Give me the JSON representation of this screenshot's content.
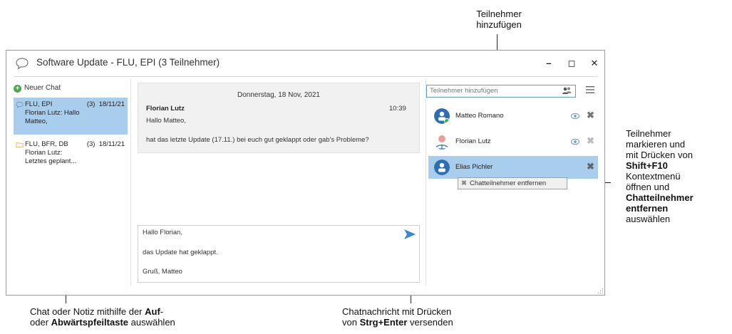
{
  "window": {
    "title": "Software Update - FLU, EPI (3 Teilnehmer)",
    "minimize": "–",
    "maximize": "◻",
    "close": "✕"
  },
  "left_pane": {
    "new_chat": "Neuer Chat",
    "chats": [
      {
        "name": "FLU, EPI",
        "count": "(3)",
        "date": "18/11/21",
        "preview1": "Florian Lutz: Hallo",
        "preview2": "Matteo,",
        "selected": true,
        "icon": "chat-bubble-icon"
      },
      {
        "name": "FLU, BFR, DB",
        "count": "(3)",
        "date": "18/11/21",
        "preview1": "Florian Lutz:",
        "preview2": "Letztes geplant...",
        "selected": false,
        "icon": "folder-icon"
      }
    ]
  },
  "messages": {
    "date": "Donnerstag, 18 Nov, 2021",
    "author": "Florian Lutz",
    "time": "10:39",
    "line1": "Hallo Matteo,",
    "line2": "hat das letzte Update (17.11.) bei euch gut geklappt oder gab's Probleme?"
  },
  "compose": {
    "line1": "Hallo Florian,",
    "line2": "das Update hat geklappt.",
    "line3": "Gruß, Matteo"
  },
  "participants": {
    "placeholder": "Teilnehmer hinzufügen",
    "list": [
      {
        "name": "Matteo Romano",
        "avatar_color": "#2e6db4",
        "status_color": "#3fae49"
      },
      {
        "name": "Florian Lutz",
        "avatar_color": "#e8a19a"
      },
      {
        "name": "Elias Pichler",
        "avatar_color": "#2e6db4",
        "selected": true
      }
    ],
    "context_menu": "Chatteilnehmer entfernen"
  },
  "annotations": {
    "top": [
      "Teilnehmer",
      "hinzufügen"
    ],
    "right": {
      "l1": "Teilnehmer",
      "l2": "markieren und",
      "l3": "mit Drücken von",
      "l4": "Shift+F10",
      "l5": "Kontextmenü",
      "l6": "öffnen und",
      "l7": "Chatteilnehmer",
      "l8": "entfernen",
      "l9": "auswählen"
    },
    "bottom_left": {
      "p1": "Chat oder Notiz mithilfe der ",
      "b1": "Auf",
      "p2": "-",
      "p3": "oder ",
      "b2": "Abwärtspfeiltaste",
      "p4": " auswählen"
    },
    "bottom_right": {
      "p1": "Chatnachricht mit Drücken",
      "p2": "von ",
      "b1": "Strg+Enter",
      "p3": " versenden"
    }
  }
}
